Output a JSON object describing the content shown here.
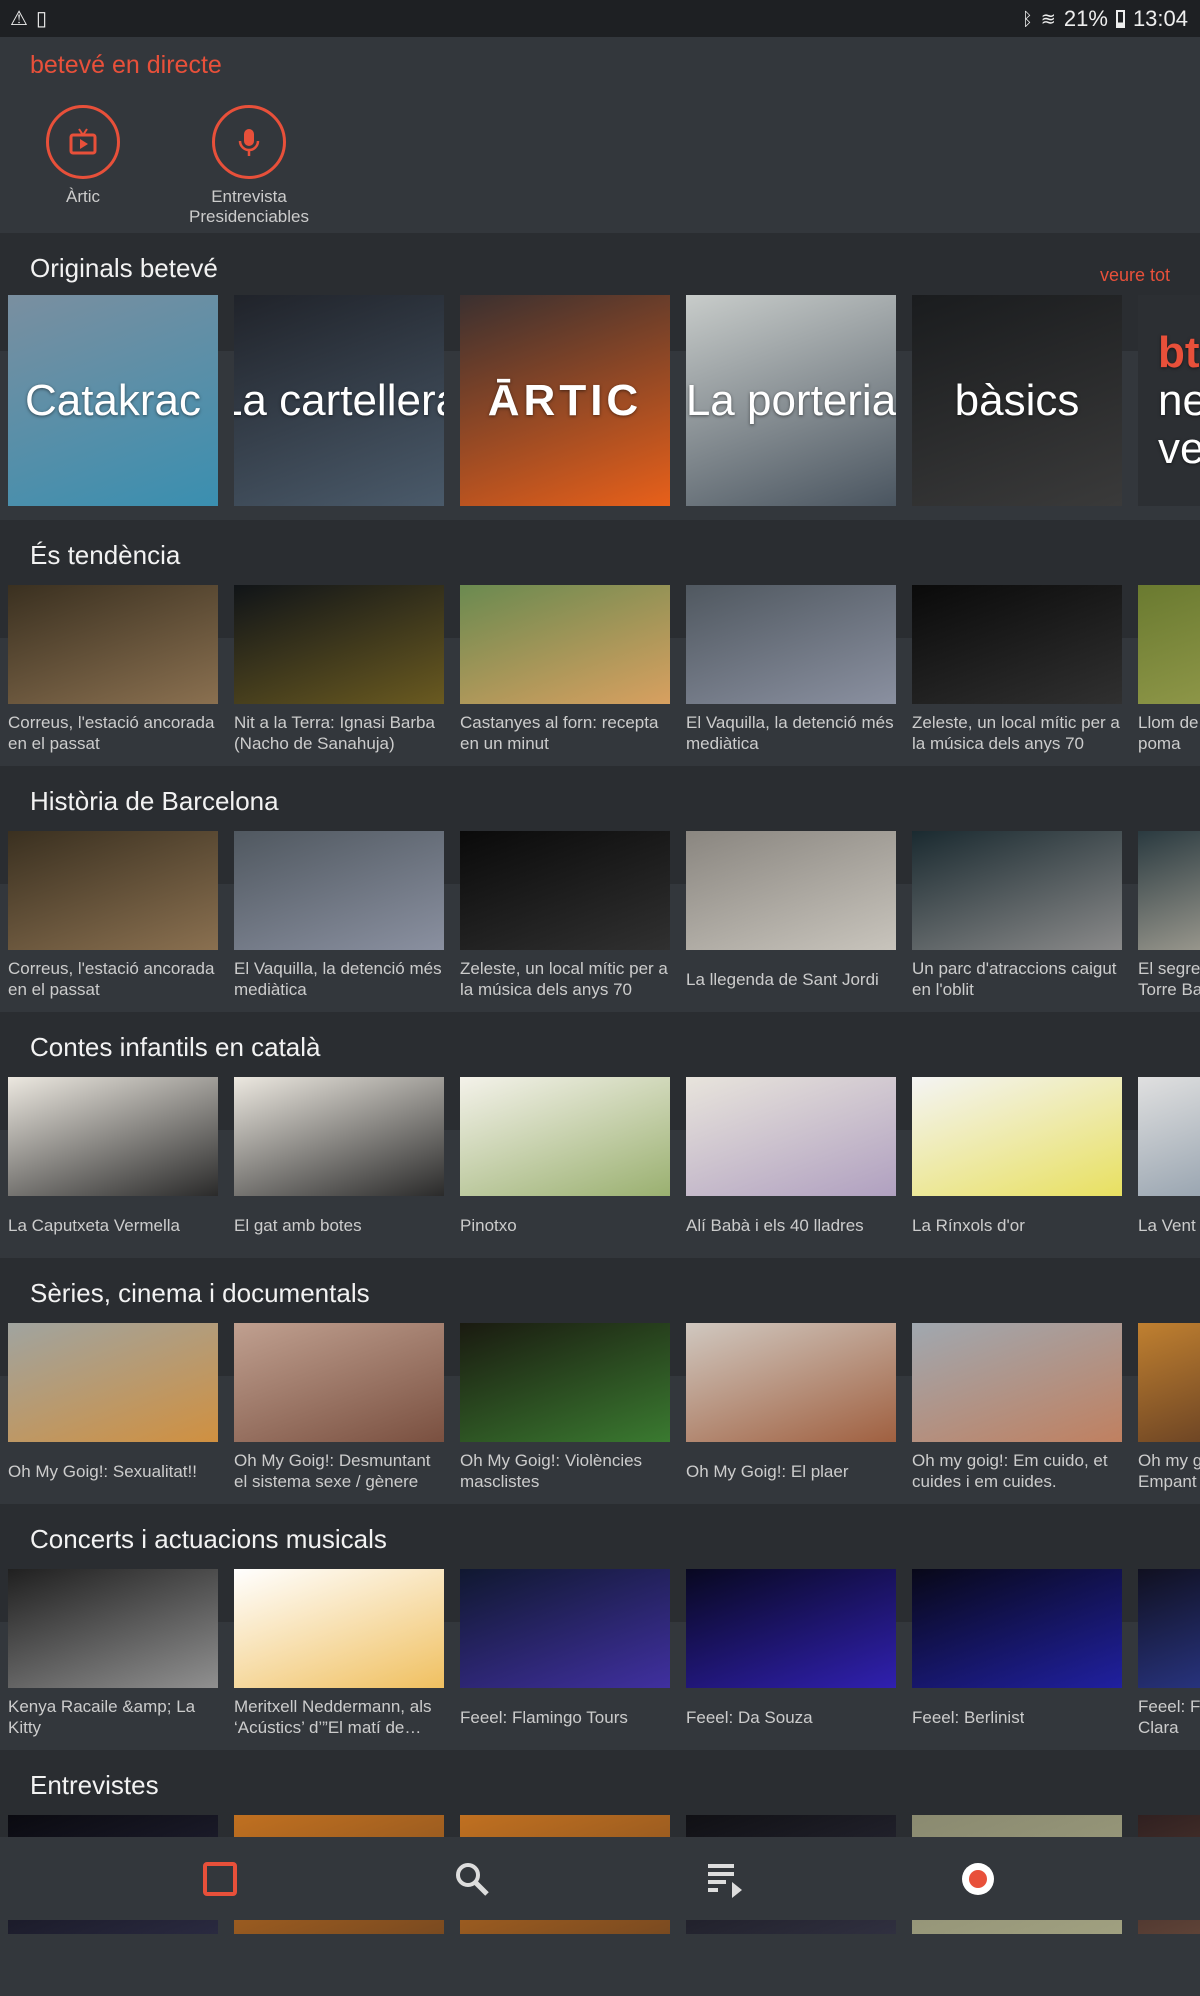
{
  "status_bar": {
    "battery": "21%",
    "time": "13:04",
    "icons": [
      "warning-icon",
      "phone-settings-icon",
      "bluetooth-icon",
      "wifi-icon",
      "battery-icon"
    ]
  },
  "accent": "#e8503a",
  "live": {
    "title": "betevé en directe",
    "items": [
      {
        "label": "Àrtic",
        "icon": "tv-icon"
      },
      {
        "label": "Entrevista\nPresidenciables",
        "icon": "microphone-icon"
      }
    ]
  },
  "originals": {
    "title": "Originals betevé",
    "see_all": "veure tot",
    "items": [
      {
        "text": "Catakrac",
        "colors": [
          "#7a8fa0",
          "#3a8fb0"
        ]
      },
      {
        "text": "La cartellera",
        "colors": [
          "#20232a",
          "#4a5a6a"
        ]
      },
      {
        "text": "ĀRTIC",
        "colors": [
          "#3a3030",
          "#e8601a"
        ]
      },
      {
        "text": "La porteria",
        "colors": [
          "#c8ccca",
          "#4a5560"
        ]
      },
      {
        "text": "bàsics",
        "colors": [
          "#1a1c1e",
          "#3a3a3a"
        ]
      },
      {
        "text": "bt\nne\nve",
        "colors": [
          "#2c2f33",
          "#2c2f33"
        ]
      }
    ]
  },
  "sections": [
    {
      "title": "És tendència",
      "items": [
        {
          "caption": "Correus, l'estació ancorada en el passat",
          "colors": [
            "#3a3020",
            "#8a7050"
          ]
        },
        {
          "caption": "Nit a la Terra: Ignasi Barba (Nacho de Sanahuja)",
          "colors": [
            "#101418",
            "#6a5a20"
          ]
        },
        {
          "caption": "Castanyes al forn: recepta en un minut",
          "colors": [
            "#6a8a50",
            "#d8a060"
          ]
        },
        {
          "caption": "El Vaquilla, la detenció més mediàtica",
          "colors": [
            "#505860",
            "#8a90a0"
          ]
        },
        {
          "caption": "Zeleste, un local mític per a la música dels anys 70",
          "colors": [
            "#0a0a0a",
            "#303030"
          ]
        },
        {
          "caption": "Llom de\npoma",
          "colors": [
            "#6a7a30",
            "#9aa050"
          ]
        }
      ]
    },
    {
      "title": "Història de Barcelona",
      "items": [
        {
          "caption": "Correus, l'estació ancorada en el passat",
          "colors": [
            "#3a3020",
            "#8a7050"
          ]
        },
        {
          "caption": "El Vaquilla, la detenció més mediàtica",
          "colors": [
            "#505860",
            "#8a90a0"
          ]
        },
        {
          "caption": "Zeleste, un local mític per a la música dels anys 70",
          "colors": [
            "#0a0a0a",
            "#303030"
          ]
        },
        {
          "caption": "La llegenda de Sant Jordi",
          "colors": [
            "#8a8680",
            "#c8c4bc"
          ]
        },
        {
          "caption": "Un parc d'atraccions caigut en l'oblit",
          "colors": [
            "#1a2a30",
            "#8a8a8a"
          ]
        },
        {
          "caption": "El segre\nTorre Ba",
          "colors": [
            "#2a3a40",
            "#c0b8a8"
          ]
        }
      ]
    },
    {
      "title": "Contes infantils en català",
      "items": [
        {
          "caption": "La Caputxeta Vermella",
          "colors": [
            "#ece8e0",
            "#2a2a2a"
          ]
        },
        {
          "caption": "El gat amb botes",
          "colors": [
            "#ece8e0",
            "#2a2a2a"
          ]
        },
        {
          "caption": "Pinotxo",
          "colors": [
            "#f4f2ea",
            "#9ab070"
          ]
        },
        {
          "caption": "Alí Babà i els 40 lladres",
          "colors": [
            "#e8e4dc",
            "#b0a0c0"
          ]
        },
        {
          "caption": "La Rínxols d'or",
          "colors": [
            "#f4f4f4",
            "#e8e060"
          ]
        },
        {
          "caption": "La Vent",
          "colors": [
            "#e0e0e0",
            "#8090a0"
          ]
        }
      ]
    },
    {
      "title": "Sèries, cinema i documentals",
      "items": [
        {
          "caption": "Oh My Goig!: Sexualitat!!",
          "colors": [
            "#a0a4a0",
            "#d09040"
          ]
        },
        {
          "caption": "Oh My Goig!: Desmuntant el sistema sexe / gènere",
          "colors": [
            "#c0a090",
            "#7a5040"
          ]
        },
        {
          "caption": "Oh My Goig!: Violències masclistes",
          "colors": [
            "#1a1a10",
            "#3a7a30"
          ]
        },
        {
          "caption": "Oh My Goig!: El plaer",
          "colors": [
            "#d0c8c0",
            "#a06040"
          ]
        },
        {
          "caption": "Oh my goig!: Em cuido, et cuides i em cuides.",
          "colors": [
            "#a0a8b0",
            "#c08060"
          ]
        },
        {
          "caption": "Oh my g\nEmpant",
          "colors": [
            "#c08030",
            "#503020"
          ]
        }
      ]
    },
    {
      "title": "Concerts i actuacions musicals",
      "items": [
        {
          "caption": "Kenya Racaile &amp; La Kitty",
          "colors": [
            "#202020",
            "#909090"
          ]
        },
        {
          "caption": "Meritxell Neddermann, als ‘Acústics’ d’”El matí de Barcelona”",
          "colors": [
            "#ffffff",
            "#f0c060"
          ]
        },
        {
          "caption": "Feeel: Flamingo Tours",
          "colors": [
            "#101830",
            "#4030a0"
          ]
        },
        {
          "caption": "Feeel: Da Souza",
          "colors": [
            "#080820",
            "#3020b0"
          ]
        },
        {
          "caption": "Feeel: Berlinist",
          "colors": [
            "#080818",
            "#2020a0"
          ]
        },
        {
          "caption": "Feeel: F\nClara",
          "colors": [
            "#101020",
            "#3040a0"
          ]
        }
      ]
    },
    {
      "title": "Entrevistes",
      "items": [
        {
          "caption": "",
          "colors": [
            "#0a0a10",
            "#2a2a40"
          ]
        },
        {
          "caption": "",
          "colors": [
            "#c07020",
            "#7a4a20"
          ]
        },
        {
          "caption": "",
          "colors": [
            "#c07020",
            "#7a4a20"
          ]
        },
        {
          "caption": "",
          "colors": [
            "#101014",
            "#303040"
          ]
        },
        {
          "caption": "",
          "colors": [
            "#8a8a70",
            "#a0a080"
          ]
        },
        {
          "caption": "",
          "colors": [
            "#302020",
            "#705040"
          ]
        }
      ]
    }
  ],
  "bottom_nav": [
    {
      "name": "home",
      "active": true
    },
    {
      "name": "search",
      "active": false
    },
    {
      "name": "playlist",
      "active": false
    },
    {
      "name": "live",
      "active": false
    }
  ]
}
